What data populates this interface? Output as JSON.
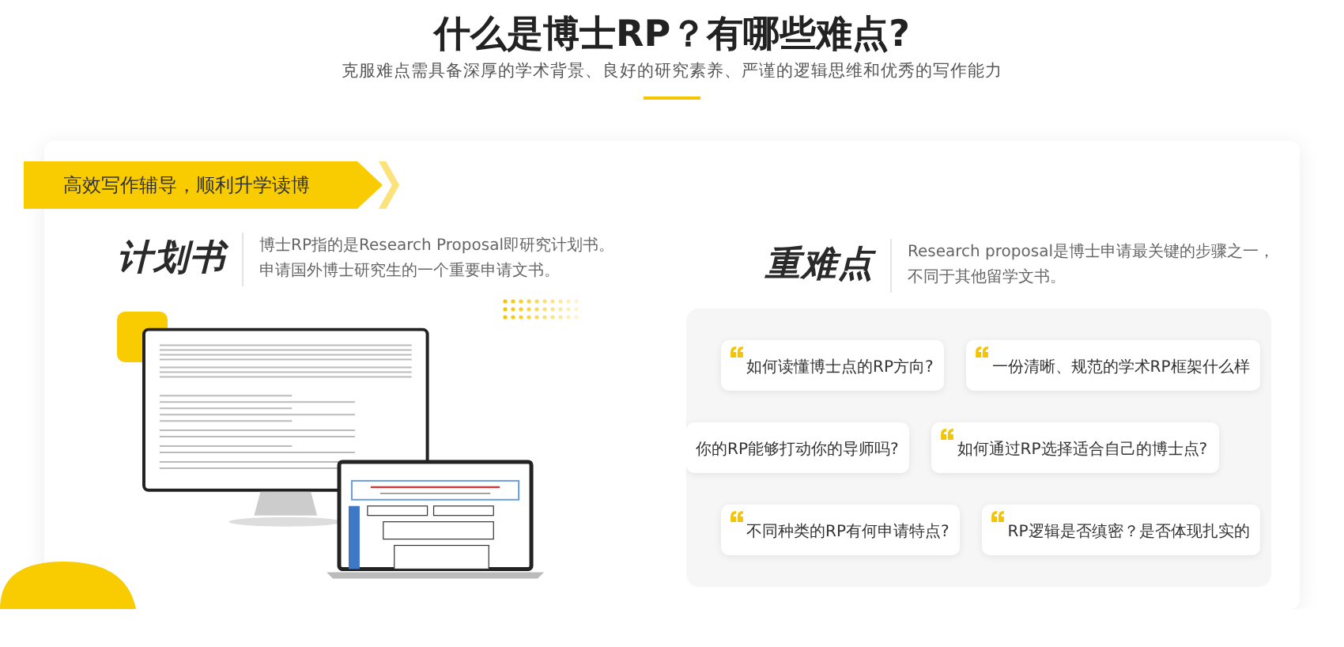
{
  "header": {
    "title": "什么是博士RP？有哪些难点?",
    "subtitle": "克服难点需具备深厚的学术背景、良好的研究素养、严谨的逻辑思维和优秀的写作能力"
  },
  "banner": {
    "label": "高效写作辅导，顺利升学读博"
  },
  "sections": [
    {
      "heading": "计划书",
      "description": [
        "博士RP指的是Research Proposal即研究计划书。",
        "申请国外博士研究生的一个重要申请文书。"
      ]
    },
    {
      "heading": "重难点",
      "description": [
        "Research proposal是博士申请最关键的步骤之一，",
        "不同于其他留学文书。"
      ]
    }
  ],
  "question_rows": [
    {
      "cards": [
        {
          "text": "如何读懂博士点的RP方向?",
          "quote": true
        },
        {
          "text": "一份清晰、规范的学术RP框架什么样",
          "quote": true
        }
      ]
    },
    {
      "cards": [
        {
          "text": "你的RP能够打动你的导师吗?",
          "quote": false
        },
        {
          "text": "如何通过RP选择适合自己的博士点?",
          "quote": true
        }
      ]
    },
    {
      "cards": [
        {
          "text": "不同种类的RP有何申请特点?",
          "quote": true
        },
        {
          "text": "RP逻辑是否缜密？是否体现扎实的",
          "quote": true
        }
      ]
    }
  ]
}
